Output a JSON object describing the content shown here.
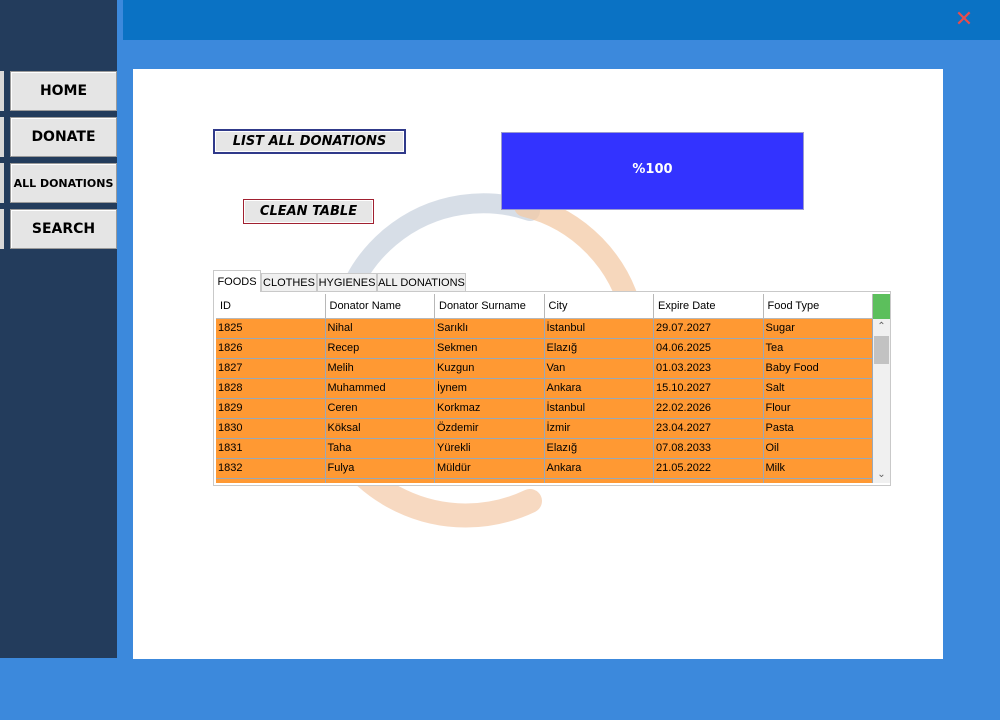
{
  "window": {
    "close_glyph": "✕"
  },
  "nav": {
    "items": [
      {
        "label": "HOME"
      },
      {
        "label": "DONATE"
      },
      {
        "label": "ALL DONATIONS"
      },
      {
        "label": "SEARCH"
      }
    ]
  },
  "buttons": {
    "list_all": "LIST ALL DONATIONS",
    "clean_table": "CLEAN TABLE"
  },
  "progress": {
    "label": "%100",
    "value": 100
  },
  "tabs": [
    {
      "label": "FOODS",
      "active": true
    },
    {
      "label": "CLOTHES",
      "active": false
    },
    {
      "label": "HYGIENES",
      "active": false
    },
    {
      "label": "ALL DONATIONS",
      "active": false
    }
  ],
  "table": {
    "columns": [
      "ID",
      "Donator Name",
      "Donator Surname",
      "City",
      "Expire Date",
      "Food Type"
    ],
    "rows": [
      [
        "1825",
        "Nihal",
        "Sarıklı",
        "İstanbul",
        "29.07.2027",
        "Sugar"
      ],
      [
        "1826",
        "Recep",
        "Sekmen",
        "Elazığ",
        "04.06.2025",
        "Tea"
      ],
      [
        "1827",
        "Melih",
        "Kuzgun",
        "Van",
        "01.03.2023",
        "Baby Food"
      ],
      [
        "1828",
        "Muhammed",
        "İynem",
        "Ankara",
        "15.10.2027",
        "Salt"
      ],
      [
        "1829",
        "Ceren",
        "Korkmaz",
        "İstanbul",
        "22.02.2026",
        "Flour"
      ],
      [
        "1830",
        "Köksal",
        "Özdemir",
        "İzmir",
        "23.04.2027",
        "Pasta"
      ],
      [
        "1831",
        "Taha",
        "Yürekli",
        "Elazığ",
        "07.08.2033",
        "Oil"
      ],
      [
        "1832",
        "Fulya",
        "Müldür",
        "Ankara",
        "21.05.2022",
        "Milk"
      ]
    ]
  },
  "colors": {
    "background": "#3c89dc",
    "titlebar": "#0a72c4",
    "sidebar": "#233c5c",
    "row_fill": "#ff9933",
    "progress_fill": "#3333ff",
    "close": "#e84c4c"
  }
}
